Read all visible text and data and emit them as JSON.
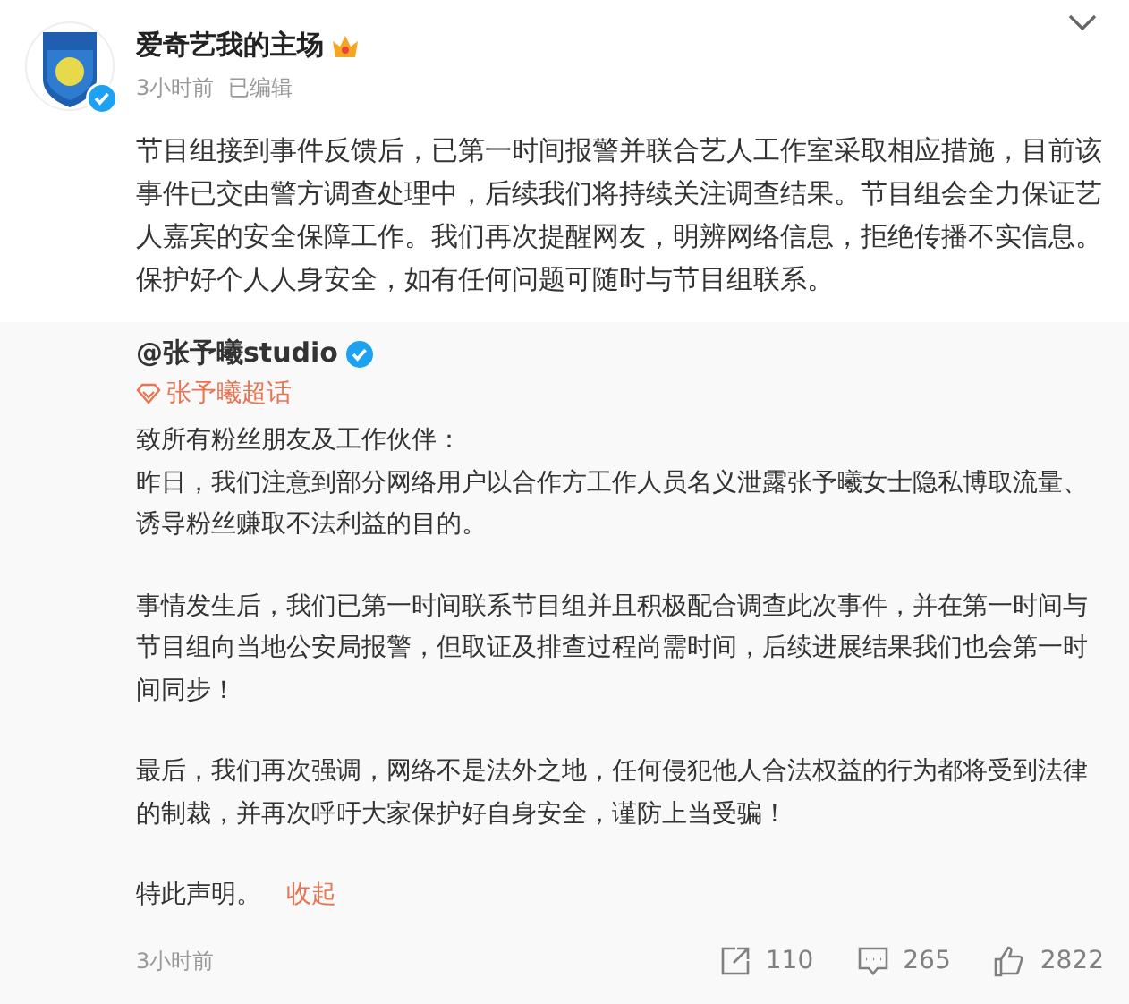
{
  "post": {
    "author": "爱奇艺我的主场",
    "time": "3小时前",
    "edited": "已编辑",
    "verified": true,
    "text": "节目组接到事件反馈后，已第一时间报警并联合艺人工作室采取相应措施，目前该事件已交由警方调查处理中，后续我们将持续关注调查结果。节目组会全力保证艺人嘉宾的安全保障工作。我们再次提醒网友，明辨网络信息，拒绝传播不实信息。保护好个人人身安全，如有任何问题可随时与节目组联系。"
  },
  "repost": {
    "author": "@张予曦studio",
    "verified": true,
    "topic": "张予曦超话",
    "greeting": "致所有粉丝朋友及工作伙伴：",
    "paragraphs": [
      "昨日，我们注意到部分网络用户以合作方工作人员名义泄露张予曦女士隐私博取流量、诱导粉丝赚取不法利益的目的。",
      "事情发生后，我们已第一时间联系节目组并且积极配合调查此次事件，并在第一时间与节目组向当地公安局报警，但取证及排查过程尚需时间，后续进展结果我们也会第一时间同步！",
      "最后，我们再次强调，网络不是法外之地，任何侵犯他人合法权益的行为都将受到法律的制裁，并再次呼吁大家保护好自身安全，谨防上当受骗！"
    ],
    "closing": "特此声明。",
    "collapse": "收起",
    "time": "3小时前",
    "actions": [
      {
        "kind": "share",
        "count": "110"
      },
      {
        "kind": "comment",
        "count": "265"
      },
      {
        "kind": "like",
        "count": "2822"
      }
    ]
  }
}
